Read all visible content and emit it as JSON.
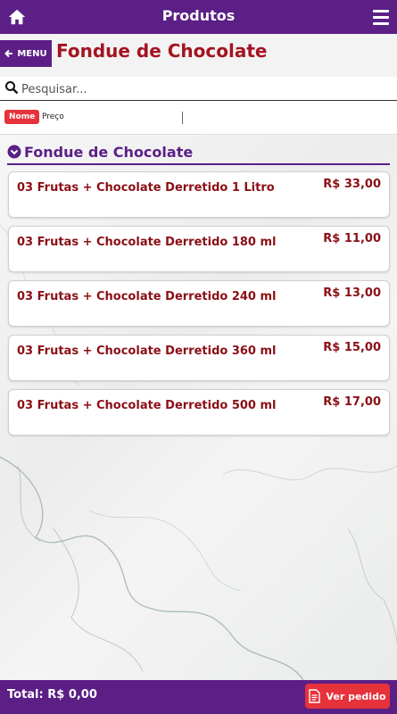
{
  "header": {
    "title": "Produtos",
    "home_icon": "home-icon",
    "menu_icon": "hamburger-icon"
  },
  "nav": {
    "menu_label": "MENU",
    "page_title": "Fondue de Chocolate"
  },
  "search": {
    "placeholder": "Pesquisar..."
  },
  "sort": {
    "nome_label": "Nome",
    "preco_label": "Preço"
  },
  "section": {
    "title": "Fondue de Chocolate"
  },
  "products": [
    {
      "name": "03 Frutas + Chocolate Derretido 1 Litro",
      "price": "R$ 33,00"
    },
    {
      "name": "03 Frutas + Chocolate Derretido 180 ml",
      "price": "R$ 11,00"
    },
    {
      "name": "03 Frutas + Chocolate Derretido 240 ml",
      "price": "R$ 13,00"
    },
    {
      "name": "03 Frutas + Chocolate Derretido 360 ml",
      "price": "R$ 15,00"
    },
    {
      "name": "03 Frutas + Chocolate Derretido 500 ml",
      "price": "R$ 17,00"
    }
  ],
  "footer": {
    "total": "Total: R$ 0,00",
    "ver_pedido": "Ver pedido"
  },
  "colors": {
    "purple": "#5b1f86",
    "red": "#e6323b",
    "dark_red": "#8b0f16"
  }
}
